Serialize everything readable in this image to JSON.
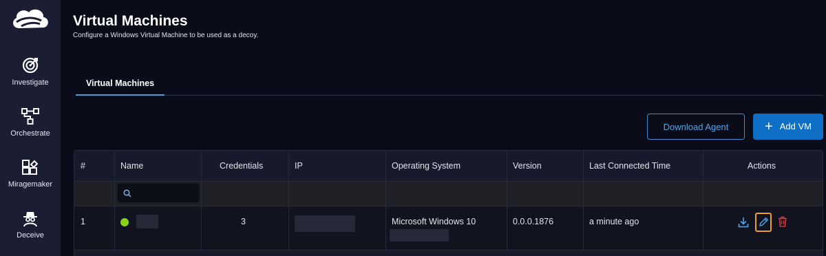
{
  "sidebar": {
    "logo": "zscaler-cloud-logo",
    "items": [
      {
        "label": "Investigate",
        "icon": "investigate-target-icon"
      },
      {
        "label": "Orchestrate",
        "icon": "orchestrate-flow-icon"
      },
      {
        "label": "Miragemaker",
        "icon": "miragemaker-icon"
      },
      {
        "label": "Deceive",
        "icon": "deceive-spy-icon"
      }
    ]
  },
  "header": {
    "title": "Virtual Machines",
    "subtitle": "Configure a Windows Virtual Machine to be used as a decoy."
  },
  "tabs": [
    {
      "label": "Virtual Machines",
      "active": true
    }
  ],
  "toolbar": {
    "download_label": "Download Agent",
    "add_label": "Add VM"
  },
  "table": {
    "columns": [
      "#",
      "Name",
      "Credentials",
      "IP",
      "Operating System",
      "Version",
      "Last Connected Time",
      "Actions"
    ],
    "search_placeholder": "",
    "rows": [
      {
        "index": "1",
        "status": "connected",
        "status_color": "#8bd117",
        "name": "",
        "credentials": "3",
        "ip": "",
        "os": "Microsoft Windows 10",
        "version": "0.0.0.1876",
        "last_connected": "a minute ago",
        "actions": [
          "download-icon",
          "edit-pencil-icon",
          "delete-trash-icon"
        ]
      }
    ]
  },
  "colors": {
    "background": "#0b0c19",
    "sidebar": "#1b1d33",
    "accent": "#0f6fc6",
    "link": "#56a6e6",
    "delete": "#e0323c",
    "highlight": "#f39d2a"
  }
}
